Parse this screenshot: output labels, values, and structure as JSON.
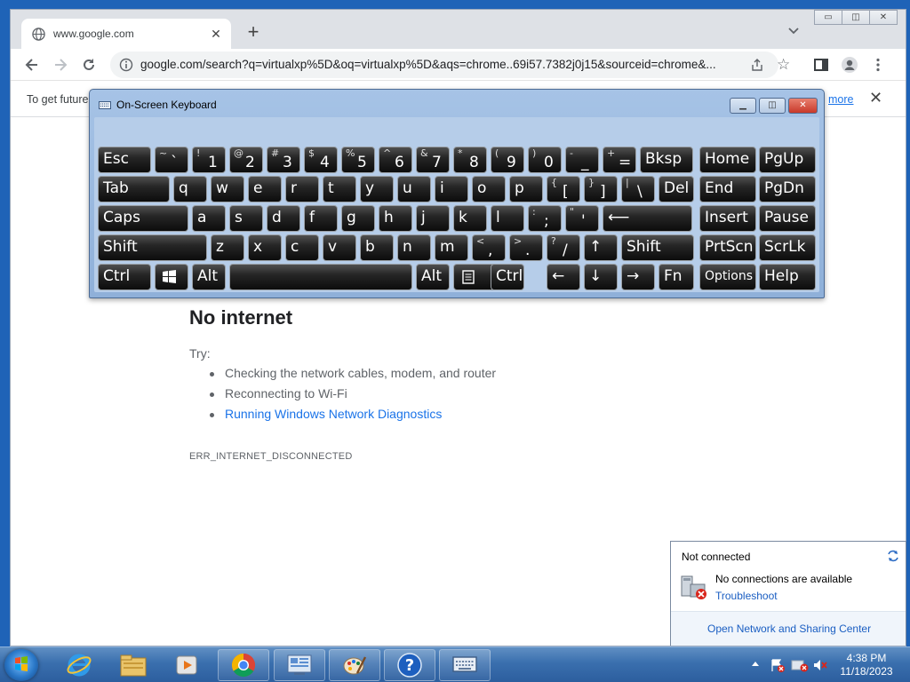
{
  "browser": {
    "tab_title": "www.google.com",
    "url": "google.com/search?q=virtualxp%5D&oq=virtualxp%5D&aqs=chrome..69i57.7382j0j15&sourceid=chrome&...",
    "infobar_text": "To get future",
    "infobar_link": "more"
  },
  "error_page": {
    "title": "No internet",
    "try_label": "Try:",
    "suggestions": [
      "Checking the network cables, modem, and router",
      "Reconnecting to Wi-Fi",
      "Running Windows Network Diagnostics"
    ],
    "error_code": "ERR_INTERNET_DISCONNECTED"
  },
  "osk": {
    "title": "On-Screen Keyboard",
    "rows": [
      [
        {
          "main": "Esc"
        },
        {
          "sup": "~",
          "main": "`"
        },
        {
          "sup": "!",
          "main": "1"
        },
        {
          "sup": "@",
          "main": "2"
        },
        {
          "sup": "#",
          "main": "3"
        },
        {
          "sup": "$",
          "main": "4"
        },
        {
          "sup": "%",
          "main": "5"
        },
        {
          "sup": "^",
          "main": "6"
        },
        {
          "sup": "&",
          "main": "7"
        },
        {
          "sup": "*",
          "main": "8"
        },
        {
          "sup": "(",
          "main": "9"
        },
        {
          "sup": ")",
          "main": "0"
        },
        {
          "sup": "-",
          "main": "_"
        },
        {
          "sup": "+",
          "main": "="
        },
        {
          "main": "Bksp"
        },
        {
          "main": "Home"
        },
        {
          "main": "PgUp"
        }
      ],
      [
        {
          "main": "Tab"
        },
        {
          "main": "q"
        },
        {
          "main": "w"
        },
        {
          "main": "e"
        },
        {
          "main": "r"
        },
        {
          "main": "t"
        },
        {
          "main": "y"
        },
        {
          "main": "u"
        },
        {
          "main": "i"
        },
        {
          "main": "o"
        },
        {
          "main": "p"
        },
        {
          "sup": "{",
          "main": "["
        },
        {
          "sup": "}",
          "main": "]"
        },
        {
          "sup": "|",
          "main": "\\"
        },
        {
          "main": "Del"
        },
        {
          "main": "End"
        },
        {
          "main": "PgDn"
        }
      ],
      [
        {
          "main": "Caps"
        },
        {
          "main": "a"
        },
        {
          "main": "s"
        },
        {
          "main": "d"
        },
        {
          "main": "f"
        },
        {
          "main": "g"
        },
        {
          "main": "h"
        },
        {
          "main": "j"
        },
        {
          "main": "k"
        },
        {
          "main": "l"
        },
        {
          "sup": ":",
          "main": ";"
        },
        {
          "sup": "\"",
          "main": "'"
        },
        {
          "main": "⟵"
        },
        {
          "main": "Insert"
        },
        {
          "main": "Pause"
        }
      ],
      [
        {
          "main": "Shift"
        },
        {
          "main": "z"
        },
        {
          "main": "x"
        },
        {
          "main": "c"
        },
        {
          "main": "v"
        },
        {
          "main": "b"
        },
        {
          "main": "n"
        },
        {
          "main": "m"
        },
        {
          "sup": "<",
          "main": ","
        },
        {
          "sup": ">",
          "main": "."
        },
        {
          "sup": "?",
          "main": "/"
        },
        {
          "main": "↑"
        },
        {
          "main": "Shift"
        },
        {
          "main": "PrtScn"
        },
        {
          "main": "ScrLk"
        }
      ],
      [
        {
          "main": "Ctrl"
        },
        {
          "main": "win-logo"
        },
        {
          "main": "Alt"
        },
        {
          "main": ""
        },
        {
          "main": "Alt"
        },
        {
          "main": "menu"
        },
        {
          "main": "Ctrl"
        },
        {
          "main": "←"
        },
        {
          "main": "↓"
        },
        {
          "main": "→"
        },
        {
          "main": "Fn"
        },
        {
          "main": "Options"
        },
        {
          "main": "Help"
        }
      ]
    ]
  },
  "network_popup": {
    "status": "Not connected",
    "message": "No connections are available",
    "troubleshoot": "Troubleshoot",
    "footer_link": "Open Network and Sharing Center"
  },
  "taskbar": {
    "time": "4:38 PM",
    "date": "11/18/2023",
    "items": [
      "internet-explorer-icon",
      "file-explorer-icon",
      "media-player-icon",
      "chrome-icon",
      "control-panel-icon",
      "paint-icon",
      "help-icon",
      "on-screen-keyboard-icon"
    ]
  }
}
